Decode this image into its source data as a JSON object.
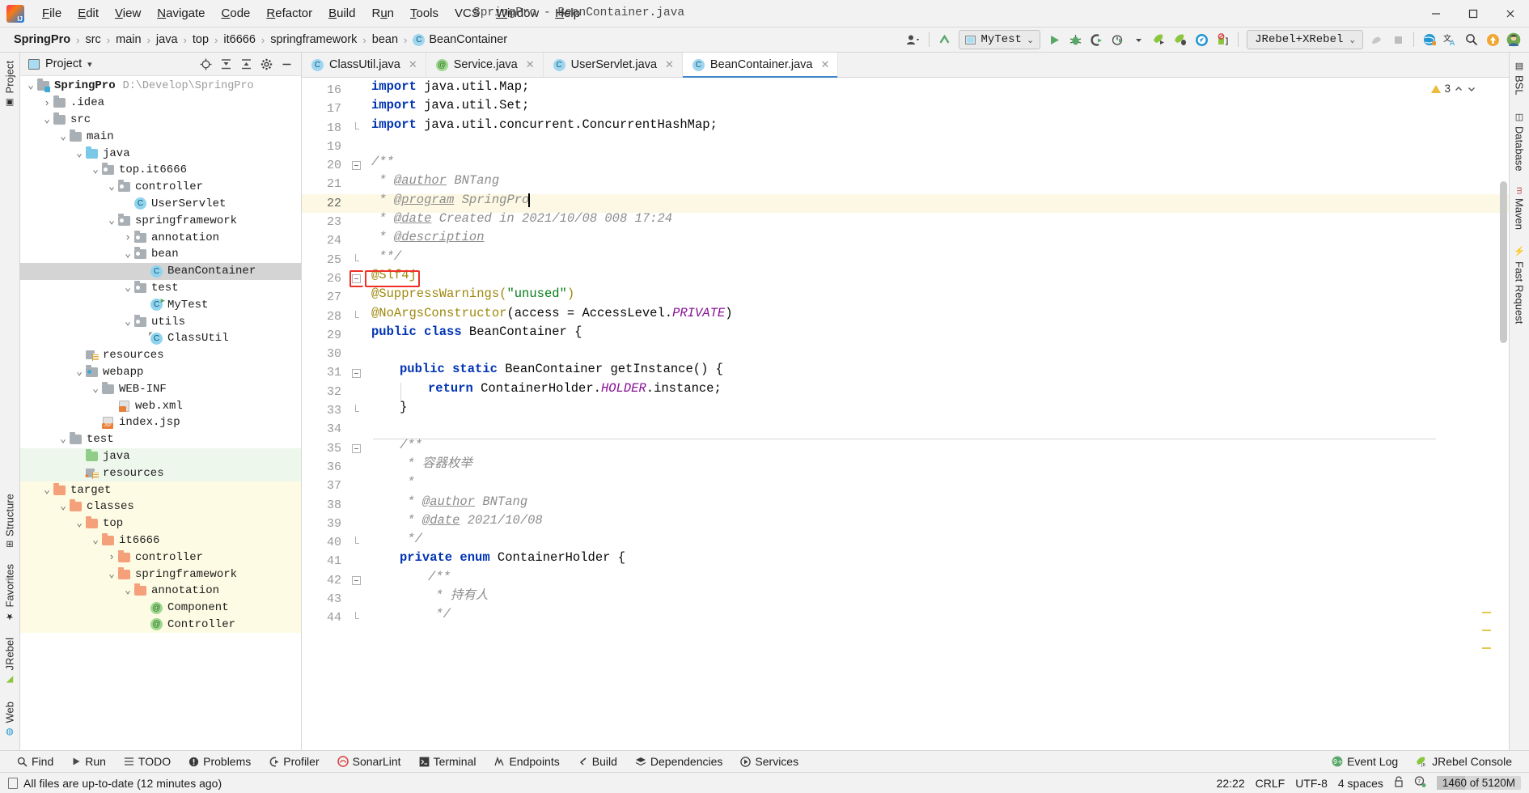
{
  "window": {
    "title": "SpringPro - BeanContainer.java",
    "controls": [
      "minimize",
      "maximize",
      "close"
    ]
  },
  "menubar": {
    "items": [
      {
        "label": "File",
        "mnemonic": "F"
      },
      {
        "label": "Edit",
        "mnemonic": "E"
      },
      {
        "label": "View",
        "mnemonic": "V"
      },
      {
        "label": "Navigate",
        "mnemonic": "N"
      },
      {
        "label": "Code",
        "mnemonic": "C"
      },
      {
        "label": "Refactor",
        "mnemonic": "R"
      },
      {
        "label": "Build",
        "mnemonic": "B"
      },
      {
        "label": "Run",
        "mnemonic": "u"
      },
      {
        "label": "Tools",
        "mnemonic": "T"
      },
      {
        "label": "VCS",
        "mnemonic": ""
      },
      {
        "label": "Window",
        "mnemonic": "W"
      },
      {
        "label": "Help",
        "mnemonic": "H"
      }
    ]
  },
  "breadcrumbs": {
    "items": [
      "SpringPro",
      "src",
      "main",
      "java",
      "top",
      "it6666",
      "springframework",
      "bean",
      "BeanContainer"
    ],
    "leaf_badge": "C"
  },
  "toolbar": {
    "run_config": {
      "label": "MyTest",
      "chevron": "⌄"
    },
    "jrebel_config": {
      "label": "JRebel+XRebel",
      "chevron": "⌄"
    },
    "icons": [
      "user-avatar-icon",
      "vcs-update-icon",
      "run-icon",
      "debug-icon",
      "run-coverage-icon",
      "profiler-icon",
      "jrebel-run-icon",
      "jrebel-debug-icon",
      "xrebel-icon",
      "jrebel-stop-icon",
      "build-icon",
      "stop-icon",
      "jrebel-globe-icon",
      "translate-icon",
      "search-icon",
      "update-icon",
      "account-icon"
    ]
  },
  "project_panel": {
    "title": "Project",
    "chevron": "▾",
    "actions": [
      "locate-icon",
      "expand-all-icon",
      "collapse-all-icon",
      "settings-icon",
      "hide-icon"
    ],
    "tree": [
      {
        "label": "SpringPro",
        "sub": "D:\\Develop\\SpringPro",
        "depth": 0,
        "arrow": "v",
        "icon": "module-folder",
        "bold": true,
        "state": "normal"
      },
      {
        "label": ".idea",
        "depth": 1,
        "arrow": ">",
        "icon": "folder-grey",
        "state": "normal"
      },
      {
        "label": "src",
        "depth": 1,
        "arrow": "v",
        "icon": "folder-grey",
        "state": "normal"
      },
      {
        "label": "main",
        "depth": 2,
        "arrow": "v",
        "icon": "folder-grey",
        "state": "normal"
      },
      {
        "label": "java",
        "depth": 3,
        "arrow": "v",
        "icon": "folder-blue",
        "state": "normal"
      },
      {
        "label": "top.it6666",
        "depth": 4,
        "arrow": "v",
        "icon": "package",
        "state": "normal"
      },
      {
        "label": "controller",
        "depth": 5,
        "arrow": "v",
        "icon": "package",
        "state": "normal"
      },
      {
        "label": "UserServlet",
        "depth": 6,
        "arrow": "",
        "icon": "class",
        "state": "normal"
      },
      {
        "label": "springframework",
        "depth": 5,
        "arrow": "v",
        "icon": "package",
        "state": "normal"
      },
      {
        "label": "annotation",
        "depth": 6,
        "arrow": ">",
        "icon": "package",
        "state": "normal"
      },
      {
        "label": "bean",
        "depth": 6,
        "arrow": "v",
        "icon": "package",
        "state": "normal"
      },
      {
        "label": "BeanContainer",
        "depth": 7,
        "arrow": "",
        "icon": "class",
        "state": "selected"
      },
      {
        "label": "test",
        "depth": 6,
        "arrow": "v",
        "icon": "package",
        "state": "normal"
      },
      {
        "label": "MyTest",
        "depth": 7,
        "arrow": "",
        "icon": "class-runnable",
        "state": "normal"
      },
      {
        "label": "utils",
        "depth": 6,
        "arrow": "v",
        "icon": "package",
        "state": "normal"
      },
      {
        "label": "ClassUtil",
        "depth": 7,
        "arrow": "",
        "icon": "class-final",
        "state": "normal"
      },
      {
        "label": "resources",
        "depth": 3,
        "arrow": "",
        "icon": "resource-folder",
        "state": "normal"
      },
      {
        "label": "webapp",
        "depth": 3,
        "arrow": "v",
        "icon": "package-src",
        "state": "normal"
      },
      {
        "label": "WEB-INF",
        "depth": 4,
        "arrow": "v",
        "icon": "folder-grey",
        "state": "normal"
      },
      {
        "label": "web.xml",
        "depth": 5,
        "arrow": "",
        "icon": "xml-file",
        "state": "normal"
      },
      {
        "label": "index.jsp",
        "depth": 4,
        "arrow": "",
        "icon": "jsp-file",
        "state": "normal"
      },
      {
        "label": "test",
        "depth": 2,
        "arrow": "v",
        "icon": "folder-grey",
        "state": "normal"
      },
      {
        "label": "java",
        "depth": 3,
        "arrow": "",
        "icon": "folder-green",
        "state": "green"
      },
      {
        "label": "resources",
        "depth": 3,
        "arrow": "",
        "icon": "test-resource-folder",
        "state": "green"
      },
      {
        "label": "target",
        "depth": 1,
        "arrow": "v",
        "icon": "folder-orange",
        "state": "yellow"
      },
      {
        "label": "classes",
        "depth": 2,
        "arrow": "v",
        "icon": "folder-orange",
        "state": "yellow"
      },
      {
        "label": "top",
        "depth": 3,
        "arrow": "v",
        "icon": "folder-orange",
        "state": "yellow"
      },
      {
        "label": "it6666",
        "depth": 4,
        "arrow": "v",
        "icon": "folder-orange",
        "state": "yellow"
      },
      {
        "label": "controller",
        "depth": 5,
        "arrow": ">",
        "icon": "folder-orange",
        "state": "yellow"
      },
      {
        "label": "springframework",
        "depth": 5,
        "arrow": "v",
        "icon": "folder-orange",
        "state": "yellow"
      },
      {
        "label": "annotation",
        "depth": 6,
        "arrow": "v",
        "icon": "folder-orange",
        "state": "yellow"
      },
      {
        "label": "Component",
        "depth": 7,
        "arrow": "",
        "icon": "annotation-class",
        "state": "yellow"
      },
      {
        "label": "Controller",
        "depth": 7,
        "arrow": "",
        "icon": "annotation-class",
        "state": "yellow"
      }
    ]
  },
  "left_stripe": {
    "tabs": [
      {
        "label": "Project",
        "icon": "project-icon"
      },
      {
        "label": "Structure",
        "icon": "structure-icon"
      },
      {
        "label": "Favorites",
        "icon": "star-icon"
      },
      {
        "label": "JRebel",
        "icon": "jrebel-icon"
      },
      {
        "label": "Web",
        "icon": "web-icon"
      }
    ]
  },
  "right_stripe": {
    "tabs": [
      {
        "label": "BSL",
        "icon": "bsl-icon"
      },
      {
        "label": "Database",
        "icon": "database-icon"
      },
      {
        "label": "Maven",
        "icon": "maven-icon"
      },
      {
        "label": "Fast Request",
        "icon": "fast-request-icon"
      }
    ]
  },
  "editor": {
    "tabs": [
      {
        "label": "ClassUtil.java",
        "badge": "C",
        "badge_kind": "class",
        "active": false
      },
      {
        "label": "Service.java",
        "badge": "@",
        "badge_kind": "annotation",
        "active": false
      },
      {
        "label": "UserServlet.java",
        "badge": "C",
        "badge_kind": "class",
        "active": false
      },
      {
        "label": "BeanContainer.java",
        "badge": "C",
        "badge_kind": "class",
        "active": true
      }
    ],
    "inspection": {
      "count": "3",
      "icon": "warning-triangle-icon"
    },
    "first_line": 16,
    "highlighted_line": 22,
    "red_box_line": 26,
    "lines": [
      {
        "n": 16,
        "tokens": [
          {
            "t": "import ",
            "c": "k"
          },
          {
            "t": "java.util.Map;",
            "c": "plain"
          }
        ],
        "indent": 0
      },
      {
        "n": 17,
        "tokens": [
          {
            "t": "import ",
            "c": "k"
          },
          {
            "t": "java.util.Set;",
            "c": "plain"
          }
        ],
        "indent": 0
      },
      {
        "n": 18,
        "tokens": [
          {
            "t": "import ",
            "c": "k"
          },
          {
            "t": "java.util.concurrent.ConcurrentHashMap;",
            "c": "plain"
          }
        ],
        "indent": 0,
        "fold": "end"
      },
      {
        "n": 19,
        "tokens": [],
        "indent": 0
      },
      {
        "n": 20,
        "tokens": [
          {
            "t": "/**",
            "c": "cmt"
          }
        ],
        "indent": 0,
        "fold": "start"
      },
      {
        "n": 21,
        "tokens": [
          {
            "t": " * ",
            "c": "cmt"
          },
          {
            "t": "@author",
            "c": "tagdoc"
          },
          {
            "t": " BNTang",
            "c": "cmt"
          }
        ],
        "indent": 0
      },
      {
        "n": 22,
        "tokens": [
          {
            "t": " * ",
            "c": "cmt"
          },
          {
            "t": "@program",
            "c": "tagdoc"
          },
          {
            "t": " SpringPro",
            "c": "cmt"
          }
        ],
        "indent": 0,
        "caret": true
      },
      {
        "n": 23,
        "tokens": [
          {
            "t": " * ",
            "c": "cmt"
          },
          {
            "t": "@date",
            "c": "tagdoc"
          },
          {
            "t": " Created in 2021/10/08 008 17:24",
            "c": "cmt"
          }
        ],
        "indent": 0
      },
      {
        "n": 24,
        "tokens": [
          {
            "t": " * ",
            "c": "cmt"
          },
          {
            "t": "@description",
            "c": "tagdoc"
          }
        ],
        "indent": 0
      },
      {
        "n": 25,
        "tokens": [
          {
            "t": " **/",
            "c": "cmt"
          }
        ],
        "indent": 0,
        "fold": "end"
      },
      {
        "n": 26,
        "tokens": [
          {
            "t": "@Slf4j",
            "c": "ann"
          }
        ],
        "indent": 0,
        "fold": "start"
      },
      {
        "n": 27,
        "tokens": [
          {
            "t": "@SuppressWarnings(",
            "c": "ann"
          },
          {
            "t": "\"unused\"",
            "c": "s"
          },
          {
            "t": ")",
            "c": "ann"
          }
        ],
        "indent": 0
      },
      {
        "n": 28,
        "tokens": [
          {
            "t": "@NoArgsConstructor",
            "c": "ann"
          },
          {
            "t": "(access = AccessLevel.",
            "c": "plain"
          },
          {
            "t": "PRIVATE",
            "c": "stat"
          },
          {
            "t": ")",
            "c": "plain"
          }
        ],
        "indent": 0,
        "fold": "end"
      },
      {
        "n": 29,
        "tokens": [
          {
            "t": "public class ",
            "c": "k"
          },
          {
            "t": "BeanContainer {",
            "c": "plain"
          }
        ],
        "indent": 0
      },
      {
        "n": 30,
        "tokens": [],
        "indent": 0
      },
      {
        "n": 31,
        "tokens": [
          {
            "t": "public static ",
            "c": "k"
          },
          {
            "t": "BeanContainer getInstance() {",
            "c": "plain"
          }
        ],
        "indent": 1,
        "fold": "start"
      },
      {
        "n": 32,
        "tokens": [
          {
            "t": "return ",
            "c": "k"
          },
          {
            "t": "ContainerHolder.",
            "c": "plain"
          },
          {
            "t": "HOLDER",
            "c": "stat"
          },
          {
            "t": ".instance;",
            "c": "plain"
          }
        ],
        "indent": 2
      },
      {
        "n": 33,
        "tokens": [
          {
            "t": "}",
            "c": "plain"
          }
        ],
        "indent": 1,
        "fold": "end"
      },
      {
        "n": 34,
        "tokens": [],
        "indent": 0
      },
      {
        "n": 35,
        "tokens": [
          {
            "t": "/**",
            "c": "cmt"
          }
        ],
        "indent": 1,
        "fold": "start",
        "sep_above": true
      },
      {
        "n": 36,
        "tokens": [
          {
            "t": " * 容器枚举",
            "c": "cmt"
          }
        ],
        "indent": 1
      },
      {
        "n": 37,
        "tokens": [
          {
            "t": " *",
            "c": "cmt"
          }
        ],
        "indent": 1
      },
      {
        "n": 38,
        "tokens": [
          {
            "t": " * ",
            "c": "cmt"
          },
          {
            "t": "@author",
            "c": "tagdoc"
          },
          {
            "t": " BNTang",
            "c": "cmt"
          }
        ],
        "indent": 1
      },
      {
        "n": 39,
        "tokens": [
          {
            "t": " * ",
            "c": "cmt"
          },
          {
            "t": "@date",
            "c": "tagdoc"
          },
          {
            "t": " 2021/10/08",
            "c": "cmt"
          }
        ],
        "indent": 1
      },
      {
        "n": 40,
        "tokens": [
          {
            "t": " */",
            "c": "cmt"
          }
        ],
        "indent": 1,
        "fold": "end"
      },
      {
        "n": 41,
        "tokens": [
          {
            "t": "private enum ",
            "c": "k"
          },
          {
            "t": "ContainerHolder {",
            "c": "plain"
          }
        ],
        "indent": 1
      },
      {
        "n": 42,
        "tokens": [
          {
            "t": "/**",
            "c": "cmt"
          }
        ],
        "indent": 2,
        "fold": "start"
      },
      {
        "n": 43,
        "tokens": [
          {
            "t": " * 持有人",
            "c": "cmt"
          }
        ],
        "indent": 2
      },
      {
        "n": 44,
        "tokens": [
          {
            "t": " */",
            "c": "cmt"
          }
        ],
        "indent": 2,
        "fold": "end"
      }
    ]
  },
  "bottom_bar": {
    "items": [
      {
        "label": "Find",
        "icon": "search-icon"
      },
      {
        "label": "Run",
        "icon": "run-icon"
      },
      {
        "label": "TODO",
        "icon": "todo-icon"
      },
      {
        "label": "Problems",
        "icon": "problems-icon"
      },
      {
        "label": "Profiler",
        "icon": "profiler-icon"
      },
      {
        "label": "SonarLint",
        "icon": "sonarlint-icon"
      },
      {
        "label": "Terminal",
        "icon": "terminal-icon"
      },
      {
        "label": "Endpoints",
        "icon": "endpoints-icon"
      },
      {
        "label": "Build",
        "icon": "build-icon"
      },
      {
        "label": "Dependencies",
        "icon": "dependencies-icon"
      },
      {
        "label": "Services",
        "icon": "services-icon"
      }
    ],
    "right_items": [
      {
        "label": "Event Log",
        "icon": "event-log-icon",
        "badge": "9+"
      },
      {
        "label": "JRebel Console",
        "icon": "jrebel-icon"
      }
    ]
  },
  "status_bar": {
    "message": "All files are up-to-date (12 minutes ago)",
    "caret_position": "22:22",
    "line_separator": "CRLF",
    "encoding": "UTF-8",
    "indent": "4 spaces",
    "lock_icon": "lock-icon",
    "inspection_icon": "inspection-icon",
    "memory": "1460 of 5120M"
  },
  "colors": {
    "accent": "#4083c9",
    "keyword": "#0033b3",
    "string": "#067d17",
    "comment": "#8c8c8c",
    "annotation": "#9e880d",
    "static_field": "#871094",
    "highlight_line": "#fcf8e3",
    "red_box": "#f03026",
    "selection": "#d4d4d4"
  }
}
